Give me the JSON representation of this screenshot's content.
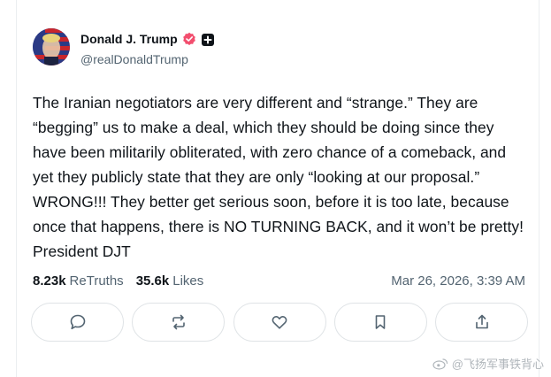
{
  "author": {
    "display_name": "Donald J. Trump",
    "handle": "@realDonaldTrump",
    "avatar_icon": "avatar-flag-portrait",
    "verified_icon": "verified-badge-icon",
    "verified_color": "#f24e6e",
    "extra_badge_icon": "plus-badge-icon"
  },
  "post": {
    "text": "The Iranian negotiators are very different and “strange.” They are “begging” us to make a deal, which they should be doing since they have been militarily obliterated, with zero chance of a comeback, and yet they publicly state that they are only “looking at our proposal.” WRONG!!! They better get serious soon, before it is too late, because once that happens, there is NO TURNING BACK, and it won’t be pretty! President DJT"
  },
  "stats": {
    "retruths_count": "8.23k",
    "retruths_label": "ReTruths",
    "likes_count": "35.6k",
    "likes_label": "Likes",
    "timestamp": "Mar 26, 2026, 3:39 AM"
  },
  "actions": [
    {
      "name": "reply",
      "icon": "comment-icon"
    },
    {
      "name": "retruth",
      "icon": "repost-icon"
    },
    {
      "name": "like",
      "icon": "heart-icon"
    },
    {
      "name": "bookmark",
      "icon": "bookmark-icon"
    },
    {
      "name": "share",
      "icon": "share-icon"
    }
  ],
  "watermark": {
    "text": "@飞扬军事铁背心"
  },
  "colors": {
    "text_primary": "#0f1419",
    "text_secondary": "#536471",
    "border": "#dfe3e6"
  }
}
